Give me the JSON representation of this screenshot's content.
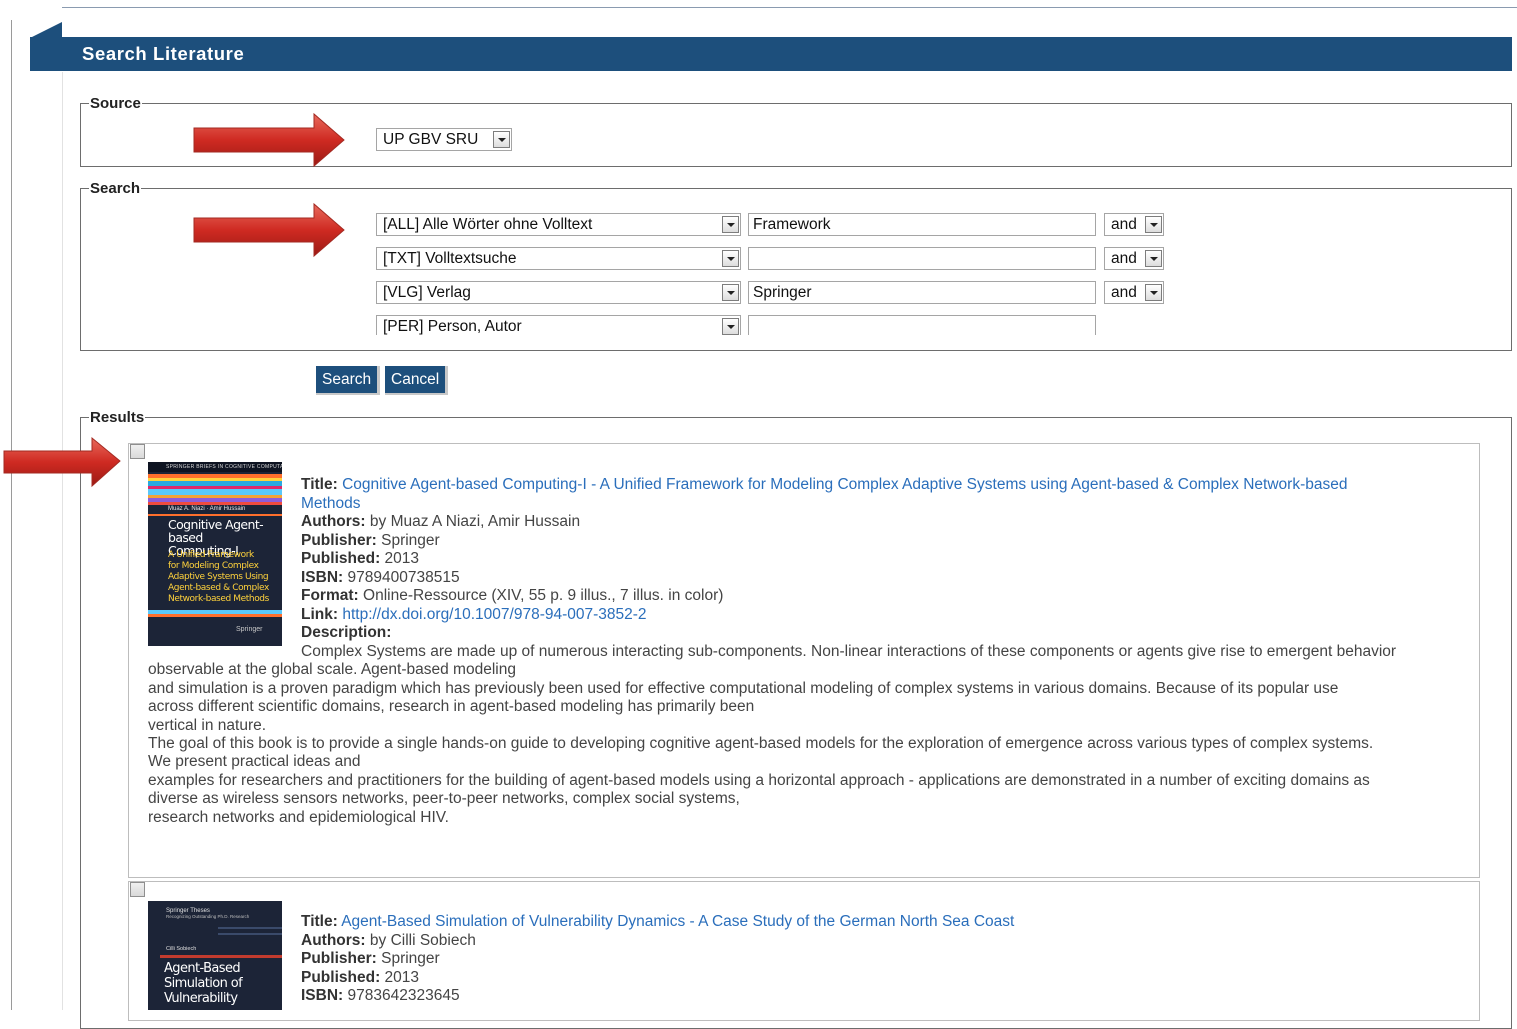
{
  "header": {
    "title": "Search Literature"
  },
  "source": {
    "legend": "Source",
    "selected": "UP GBV SRU"
  },
  "search": {
    "legend": "Search",
    "rows": [
      {
        "field": "[ALL] Alle Wörter ohne Volltext",
        "value": "Framework",
        "operator": "and"
      },
      {
        "field": "[TXT] Volltextsuche",
        "value": "",
        "operator": "and"
      },
      {
        "field": "[VLG] Verlag",
        "value": "Springer",
        "operator": "and"
      },
      {
        "field": "[PER] Person, Autor",
        "value": ""
      }
    ]
  },
  "buttons": {
    "search": "Search",
    "cancel": "Cancel"
  },
  "results": {
    "legend": "Results",
    "labels": {
      "title": "Title:",
      "authors": "Authors:",
      "publisher": "Publisher:",
      "published": "Published:",
      "isbn": "ISBN:",
      "format": "Format:",
      "link": "Link:",
      "description": "Description:"
    },
    "items": [
      {
        "title_line1": "Cognitive Agent-based Computing-I - A Unified Framework for Modeling Complex Adaptive Systems using Agent-based & Complex Network-based",
        "title_line2": "Methods",
        "authors": "by Muaz A Niazi, Amir Hussain",
        "publisher": "Springer",
        "published": "2013",
        "isbn": "9789400738515",
        "format": "Online-Ressource (XIV, 55 p. 9 illus., 7 illus. in color)",
        "link": "http://dx.doi.org/10.1007/978-94-007-3852-2",
        "description_lines": [
          "Complex Systems are made up of numerous interacting sub-components. Non-linear interactions of these components or agents give rise to emergent behavior",
          "observable at the global scale. Agent-based modeling",
          "and simulation is a proven paradigm which has previously been used for effective computational modeling of complex systems in various domains. Because of its popular use",
          "across different scientific domains, research in agent-based modeling has primarily been",
          "vertical in nature.",
          "The goal of this book is to provide a single hands-on guide to developing cognitive agent-based models for the exploration of emergence across various types of complex systems.",
          "We present practical ideas and",
          "examples for researchers and practitioners for the building of agent-based models using a horizontal approach - applications are demonstrated in a number of exciting domains as",
          "diverse as wireless sensors networks, peer-to-peer networks, complex social systems,",
          "research networks and epidemiological HIV."
        ],
        "cover": {
          "series": "SPRINGER BRIEFS IN COGNITIVE COMPUTATION",
          "authors": "Muaz A. Niazi · Amir Hussain",
          "title_lines": [
            "Cognitive Agent-based",
            "Computing-I"
          ],
          "subtitle_lines": [
            "A Unified Framework",
            "for Modeling Complex",
            "Adaptive Systems Using",
            "Agent-based & Complex",
            "Network-based Methods"
          ],
          "publisher": "Springer"
        }
      },
      {
        "title": "Agent-Based Simulation of Vulnerability Dynamics - A Case Study of the German North Sea Coast",
        "authors": "by Cilli Sobiech",
        "publisher": "Springer",
        "published": "2013",
        "isbn": "9783642323645",
        "cover": {
          "series": "Springer Theses",
          "series_sub": "Recognizing Outstanding Ph.D. Research",
          "author": "Cilli Sobiech",
          "title_lines": [
            "Agent-Based",
            "Simulation of",
            "Vulnerability"
          ]
        }
      }
    ]
  },
  "colors": {
    "header_bg": "#1d4f7c",
    "link": "#2a6ebb",
    "arrow": "#d3312a"
  }
}
